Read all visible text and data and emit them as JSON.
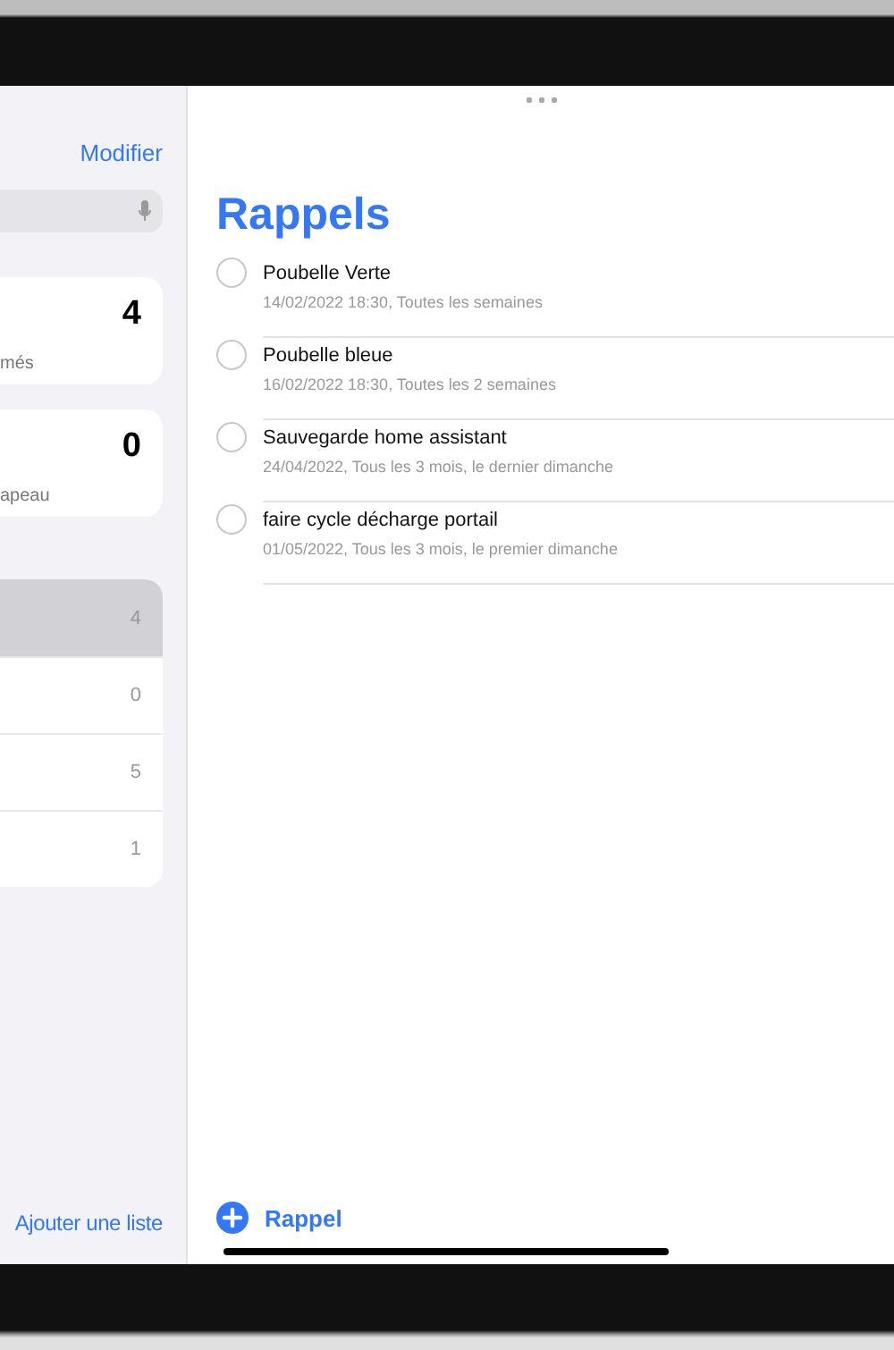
{
  "sidebar": {
    "edit_button": "Modifier",
    "smart_lists": [
      {
        "count": "4",
        "label": "més"
      },
      {
        "count": "0",
        "label": "apeau"
      }
    ],
    "lists": [
      {
        "count": "4",
        "selected": true
      },
      {
        "count": "0",
        "selected": false
      },
      {
        "count": "5",
        "selected": false
      },
      {
        "count": "1",
        "selected": false
      }
    ],
    "add_list": "Ajouter une liste"
  },
  "main": {
    "title": "Rappels",
    "reminders": [
      {
        "title": "Poubelle Verte",
        "detail": "14/02/2022 18:30, Toutes les semaines",
        "completed": false
      },
      {
        "title": "Poubelle bleue",
        "detail": "16/02/2022 18:30, Toutes les 2 semaines",
        "completed": false
      },
      {
        "title": "Sauvegarde home assistant",
        "detail": "24/04/2022, Tous les 3 mois, le dernier dimanche",
        "completed": false
      },
      {
        "title": "faire cycle décharge portail",
        "detail": "01/05/2022, Tous les 3 mois, le premier dimanche",
        "completed": false
      }
    ],
    "add_button": "Rappel"
  }
}
